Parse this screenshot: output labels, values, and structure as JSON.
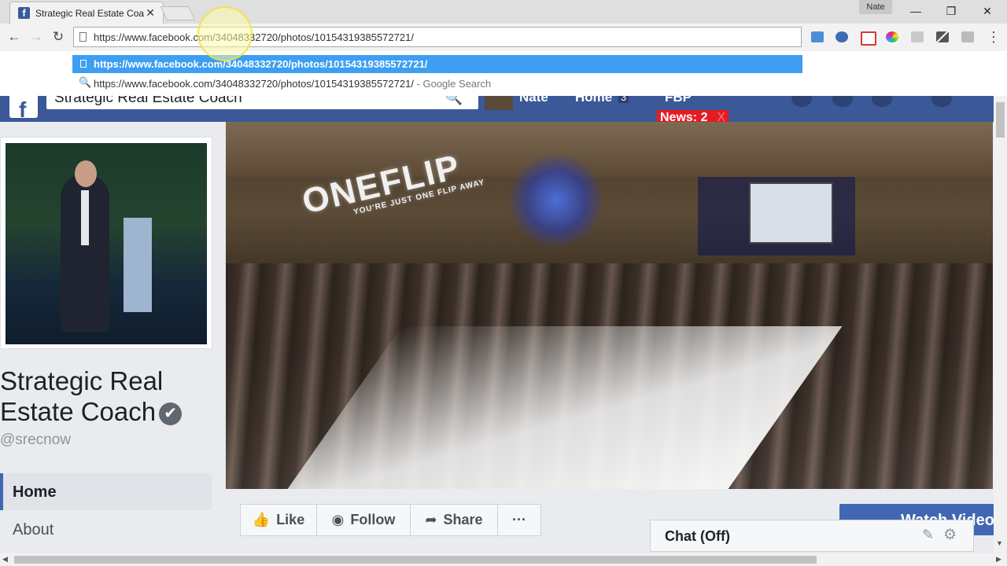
{
  "browser": {
    "tab_title": "Strategic Real Estate Coa",
    "favicon_letter": "f",
    "tab_close": "✕",
    "profile_name": "Nate",
    "window_controls": {
      "minimize": "—",
      "restore": "❐",
      "close": "✕"
    },
    "nav": {
      "back": "←",
      "forward": "→",
      "reload": "↻"
    },
    "address": "https://www.facebook.com/34048332720/photos/10154319385572721/",
    "menu_icon": "⋮",
    "suggestions": [
      {
        "text": "https://www.facebook.com/34048332720/photos/10154319385572721/",
        "selected": true
      },
      {
        "text": "https://www.facebook.com/34048332720/photos/10154319385572721/",
        "suffix": " - Google Search",
        "icon": "🔍"
      }
    ]
  },
  "fb_bar": {
    "logo": "f",
    "search_value": "Strategic Real Estate Coach",
    "search_icon": "🔍",
    "user": "Nate",
    "home_label": "Home",
    "home_badge": "3",
    "extra_label": "FBP",
    "news_label": "News: 2",
    "news_close": "X"
  },
  "page": {
    "name": "Strategic Real Estate Coach",
    "verified_icon": "✔",
    "handle": "@srecnow",
    "nav_items": [
      "Home",
      "About"
    ]
  },
  "cover": {
    "logo_text": "ONEFLIP",
    "logo_tagline": "YOU'RE JUST ONE FLIP AWAY"
  },
  "actions": {
    "like": {
      "icon": "👍",
      "label": "Like"
    },
    "follow": {
      "icon": "◉",
      "label": "Follow"
    },
    "share": {
      "icon": "➦",
      "label": "Share"
    },
    "more": "···"
  },
  "watch_label": "Watch Video",
  "chat": {
    "label": "Chat (Off)",
    "edit_icon": "✎",
    "settings_icon": "⚙"
  },
  "colors": {
    "fb_blue": "#3b5998",
    "selection_blue": "#3d9ef2",
    "news_red": "#e31b23"
  }
}
